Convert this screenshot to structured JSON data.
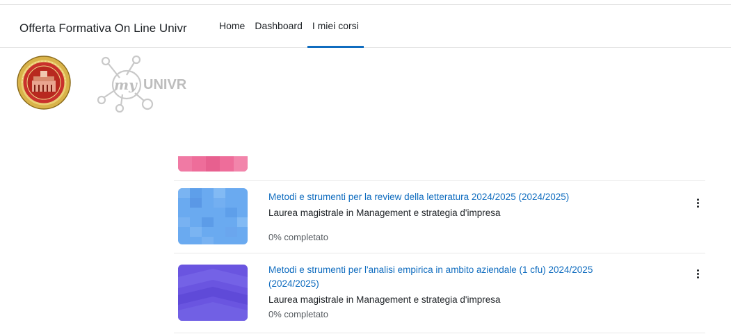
{
  "navbar": {
    "site_name": "Offerta Formativa On Line Univr",
    "links": [
      {
        "label": "Home",
        "active": false
      },
      {
        "label": "Dashboard",
        "active": false
      },
      {
        "label": "I miei corsi",
        "active": true
      }
    ],
    "accent_color": "#0f6cbf"
  },
  "logos": {
    "seal_icon": "university-seal-icon",
    "brand_icon": "myunivr-logo-icon",
    "brand_text": "UNIVR"
  },
  "courses": [
    {
      "title": "Metodi e strumenti per la review della letteratura 2024/2025 (2024/2025)",
      "category": "Laurea magistrale in Management e strategia d'impresa",
      "progress": "0% completato",
      "progress_value": 0
    },
    {
      "title": "Metodi e strumenti per l'analisi empirica in ambito aziendale (1 cfu) 2024/2025 (2024/2025)",
      "category": "Laurea magistrale in Management e strategia d'impresa",
      "progress": "0% completato",
      "progress_value": 0
    }
  ],
  "colors": {
    "link": "#0f6cbf",
    "thumb_pink": "#ee6d9a",
    "thumb_blue": "#6aaaf0",
    "thumb_purple": "#6a55e0"
  }
}
